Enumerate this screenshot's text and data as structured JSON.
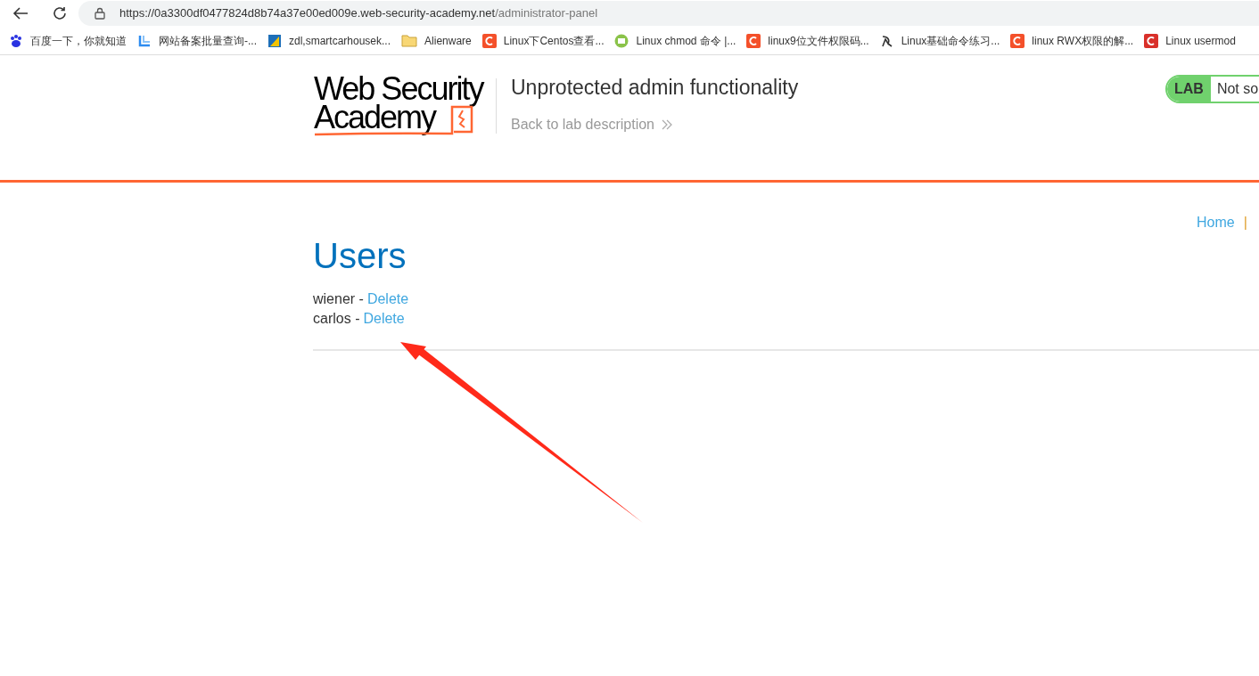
{
  "browser": {
    "url_host": "https://0a3300df0477824d8b74a37e00ed009e.web-security-academy.net",
    "url_path": "/administrator-panel"
  },
  "bookmarks": [
    {
      "kind": "paw",
      "label": "百度一下，你就知道"
    },
    {
      "kind": "corner",
      "label": "网站备案批量查询-..."
    },
    {
      "kind": "tile",
      "label": "zdl,smartcarhousek..."
    },
    {
      "kind": "folder",
      "label": "Alienware"
    },
    {
      "kind": "c",
      "label": "Linux下Centos查看...",
      "color": "#f4502a"
    },
    {
      "kind": "round",
      "label": "Linux chmod 命令 |..."
    },
    {
      "kind": "c",
      "label": "linux9位文件权限码...",
      "color": "#f4502a"
    },
    {
      "kind": "swirl",
      "label": "Linux基础命令练习..."
    },
    {
      "kind": "c",
      "label": "linux RWX权限的解...",
      "color": "#f4502a"
    },
    {
      "kind": "c",
      "label": "Linux usermod",
      "color": "#d9302a"
    }
  ],
  "header": {
    "logo_line1": "Web Security",
    "logo_line2": "Academy",
    "lab_title": "Unprotected admin functionality",
    "back_link": "Back to lab description",
    "lab_badge": "LAB",
    "lab_status": "Not so"
  },
  "nav": {
    "links": [
      "Home"
    ],
    "separator": "|"
  },
  "users_heading": "Users",
  "users": [
    {
      "name": "wiener",
      "separator": "-",
      "action": "Delete"
    },
    {
      "name": "carlos",
      "separator": "-",
      "action": "Delete"
    }
  ],
  "annotation": {
    "kind": "arrow"
  }
}
